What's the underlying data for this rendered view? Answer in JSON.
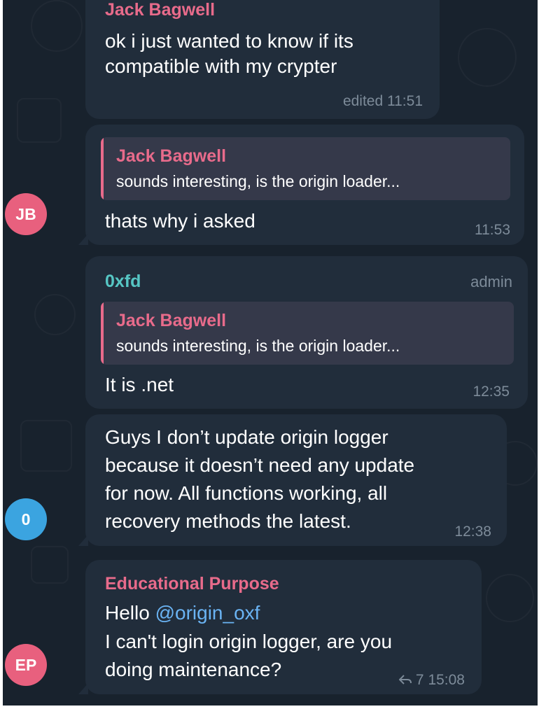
{
  "colors": {
    "background": "#18222d",
    "bubble": "#212d3b",
    "accent_pink": "#e86b8b",
    "accent_teal": "#56c6c4",
    "mention": "#6ab3f3",
    "meta": "#7d8b99"
  },
  "messages": [
    {
      "sender": "Jack Bagwell",
      "lines": [
        "ok i just wanted to know if its",
        "compatible with my crypter"
      ],
      "time": "edited 11:51"
    },
    {
      "reply_to": {
        "name": "Jack Bagwell",
        "text": "sounds interesting, is the origin loader..."
      },
      "text": "thats why i asked",
      "time": "11:53",
      "avatar": {
        "initials": "JB",
        "color": "#e8607e",
        "icon": "avatar"
      }
    },
    {
      "sender": "0xfd",
      "badge": "admin",
      "reply_to": {
        "name": "Jack Bagwell",
        "text": "sounds interesting, is the origin loader..."
      },
      "text": "It is .net",
      "time": "12:35"
    },
    {
      "lines": [
        "Guys I don’t update origin logger",
        "because it doesn’t need any update",
        "for now. All functions working, all",
        "recovery methods the latest."
      ],
      "time": "12:38",
      "avatar": {
        "initials": "0",
        "color": "#3ba4e0",
        "icon": "avatar"
      }
    },
    {
      "sender": "Educational Purpose",
      "greeting": "Hello",
      "mention": "@origin_oxf",
      "lines": [
        "I can't login origin logger, are you",
        "doing maintenance?"
      ],
      "replies_icon": "reply-arrow-icon",
      "reply_count": "7",
      "time": "15:08",
      "avatar": {
        "initials": "EP",
        "color": "#e8607e",
        "icon": "avatar"
      }
    }
  ]
}
